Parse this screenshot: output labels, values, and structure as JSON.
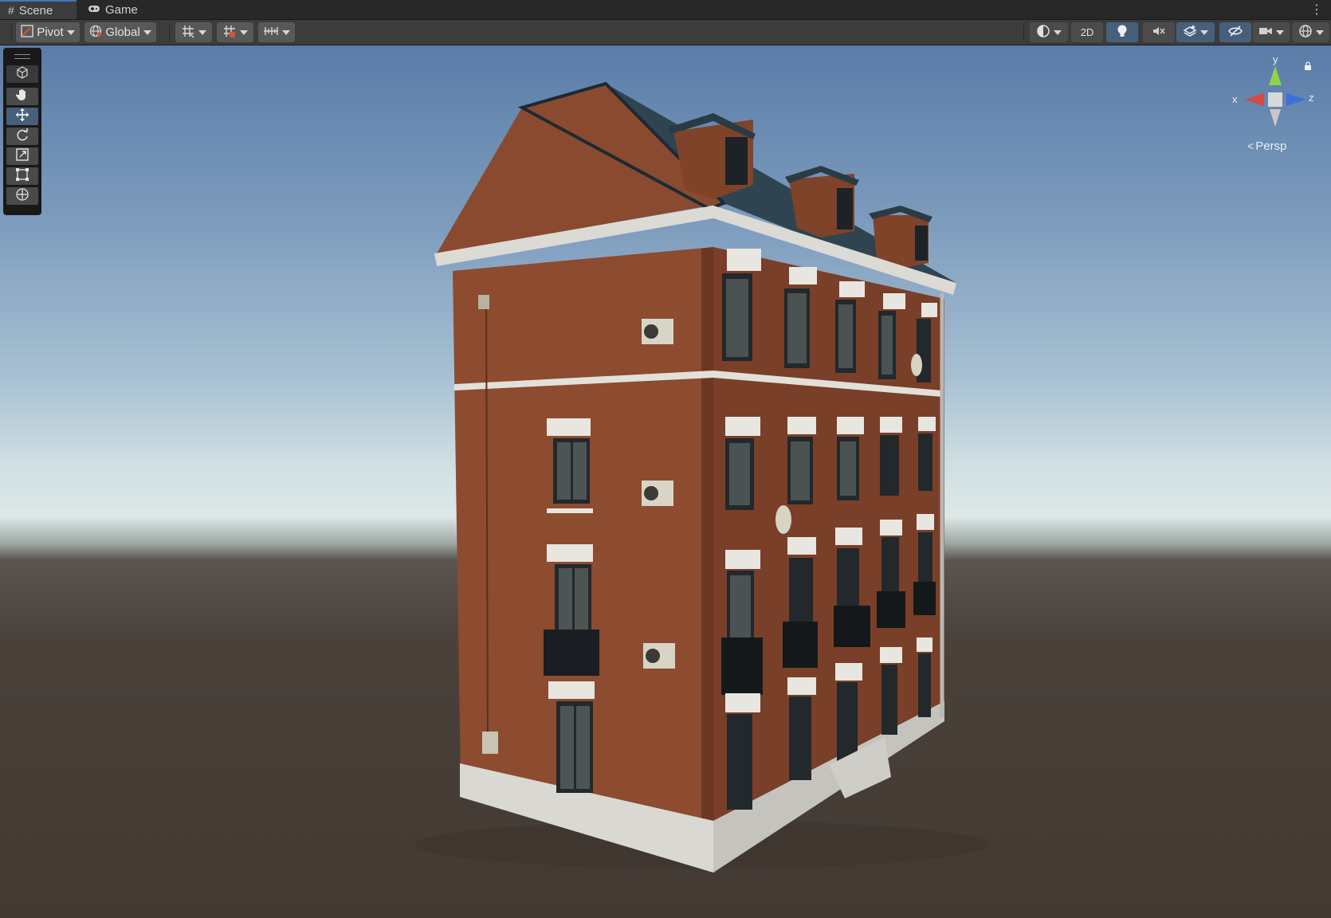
{
  "tabs": [
    {
      "label": "Scene",
      "icon": "grid-icon",
      "active": true
    },
    {
      "label": "Game",
      "icon": "gamepad-icon",
      "active": false
    }
  ],
  "toolbar": {
    "pivot_label": "Pivot",
    "global_label": "Global",
    "mode_2d_label": "2D"
  },
  "scene": {
    "view_mode_label": "Persp",
    "gizmo_axes": {
      "x": "x",
      "y": "y",
      "z": "z"
    }
  },
  "colors": {
    "accent": "#46607c",
    "axis_x": "#d44a42",
    "axis_y": "#8fd44a",
    "axis_z": "#3d6fd8",
    "brick": "#8b4a2f"
  }
}
